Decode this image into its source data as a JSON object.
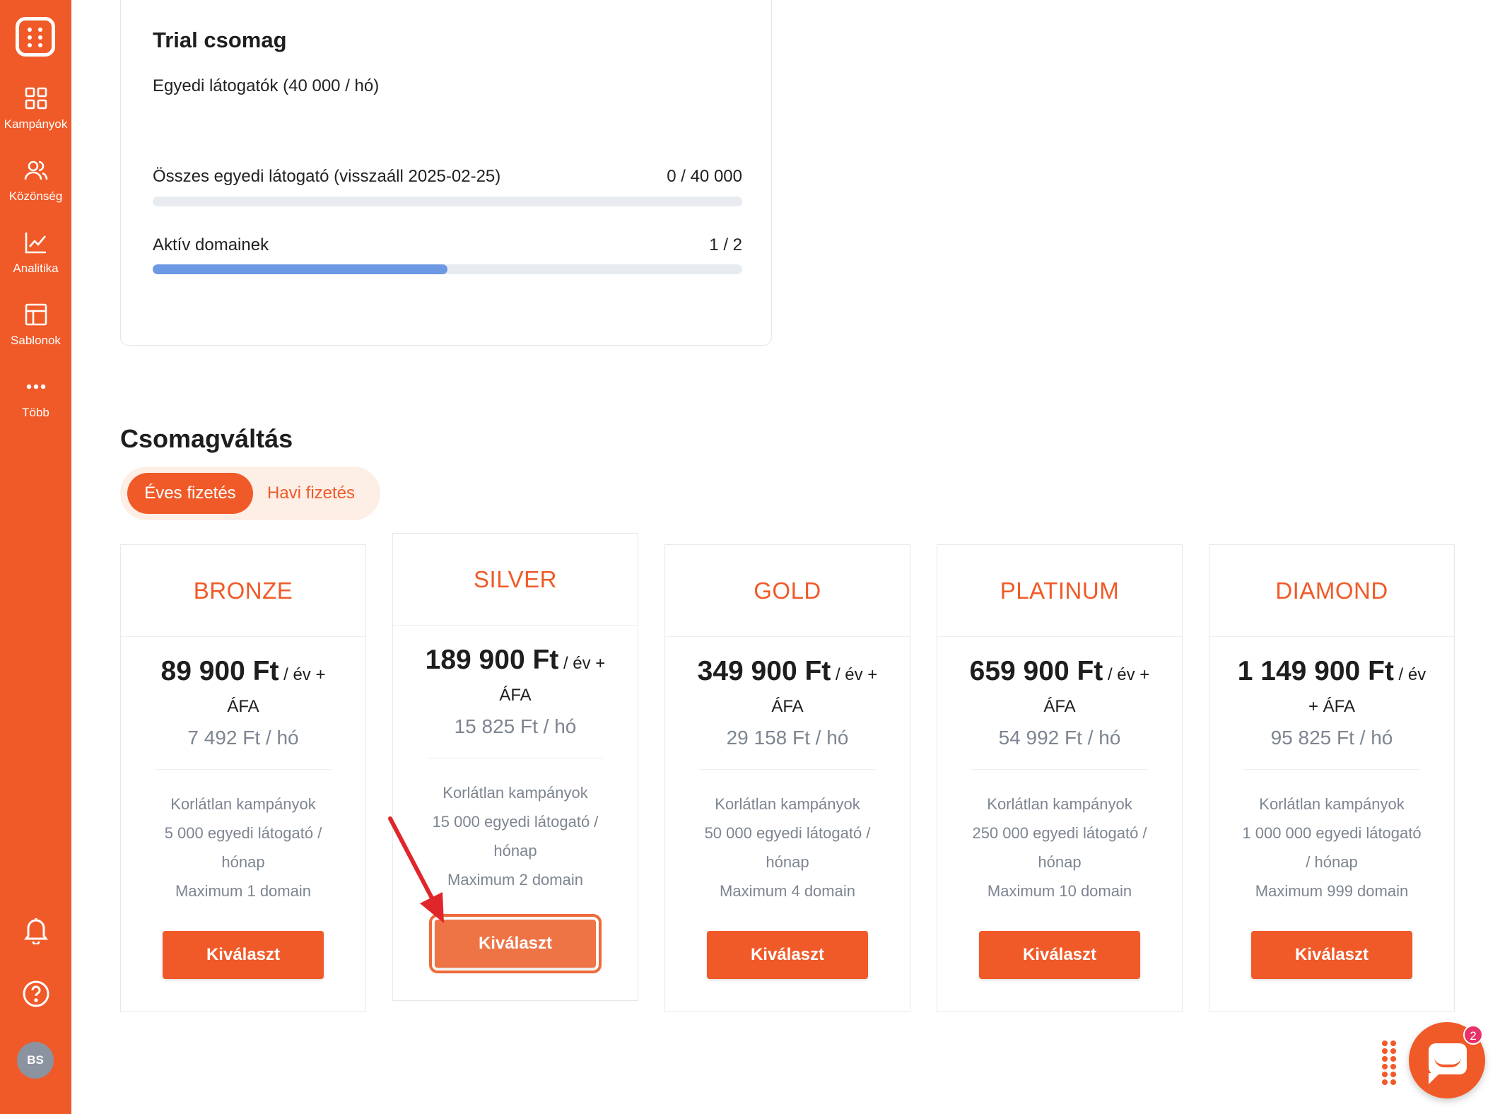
{
  "sidebar": {
    "items": [
      {
        "label": "Kampányok",
        "icon": "grid-icon"
      },
      {
        "label": "Közönség",
        "icon": "users-icon"
      },
      {
        "label": "Analitika",
        "icon": "chart-icon"
      },
      {
        "label": "Sablonok",
        "icon": "template-icon"
      },
      {
        "label": "Több",
        "icon": "more-icon"
      }
    ],
    "avatar": "BS"
  },
  "trial": {
    "title": "Trial csomag",
    "subtitle": "Egyedi látogatók (40 000 / hó)",
    "usage": [
      {
        "label": "Összes egyedi látogató (visszaáll 2025-02-25)",
        "value": "0 / 40 000",
        "fraction": 0.0
      },
      {
        "label": "Aktív domainek",
        "value": "1 / 2",
        "fraction": 0.5
      }
    ]
  },
  "section": {
    "title": "Csomagváltás",
    "toggle": {
      "active": "Éves fizetés",
      "inactive": "Havi fizetés"
    }
  },
  "plans": [
    {
      "name": "BRONZE",
      "price": "89 900 Ft",
      "unit": " / év + ÁFA",
      "monthly": "7 492 Ft / hó",
      "features": [
        "Korlátlan kampányok",
        "5 000 egyedi látogató / hónap",
        "Maximum 1 domain"
      ],
      "button": "Kiválaszt"
    },
    {
      "name": "SILVER",
      "price": "189 900 Ft",
      "unit": " / év + ÁFA",
      "monthly": "15 825 Ft / hó",
      "features": [
        "Korlátlan kampányok",
        "15 000 egyedi látogató / hónap",
        "Maximum 2 domain"
      ],
      "button": "Kiválaszt"
    },
    {
      "name": "GOLD",
      "price": "349 900 Ft",
      "unit": " / év + ÁFA",
      "monthly": "29 158 Ft / hó",
      "features": [
        "Korlátlan kampányok",
        "50 000 egyedi látogató / hónap",
        "Maximum 4 domain"
      ],
      "button": "Kiválaszt"
    },
    {
      "name": "PLATINUM",
      "price": "659 900 Ft",
      "unit": " / év + ÁFA",
      "monthly": "54 992 Ft / hó",
      "features": [
        "Korlátlan kampányok",
        "250 000 egyedi látogató / hónap",
        "Maximum 10 domain"
      ],
      "button": "Kiválaszt"
    },
    {
      "name": "DIAMOND",
      "price": "1 149 900 Ft",
      "unit": " / év + ÁFA",
      "monthly": "95 825 Ft / hó",
      "features": [
        "Korlátlan kampányok",
        "1 000 000 egyedi látogató / hónap",
        "Maximum 999 domain"
      ],
      "button": "Kiválaszt"
    }
  ],
  "chat": {
    "badge": "2"
  },
  "colors": {
    "brand": "#f05a28",
    "progress": "#6d98e4",
    "annotation_arrow": "#e0262b"
  }
}
